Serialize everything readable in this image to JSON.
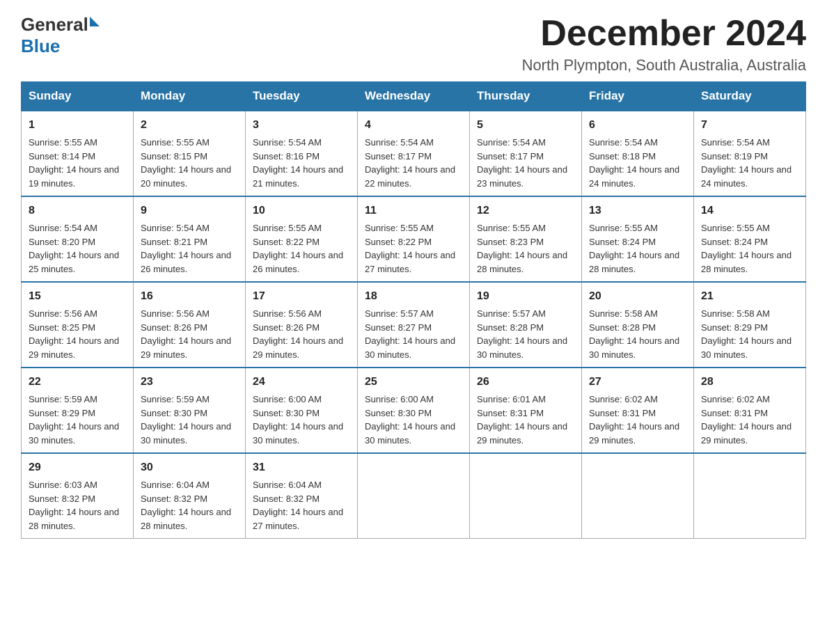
{
  "logo": {
    "general": "General",
    "blue": "Blue"
  },
  "title": "December 2024",
  "location": "North Plympton, South Australia, Australia",
  "weekdays": [
    "Sunday",
    "Monday",
    "Tuesday",
    "Wednesday",
    "Thursday",
    "Friday",
    "Saturday"
  ],
  "weeks": [
    [
      {
        "day": "1",
        "sunrise": "5:55 AM",
        "sunset": "8:14 PM",
        "daylight": "14 hours and 19 minutes."
      },
      {
        "day": "2",
        "sunrise": "5:55 AM",
        "sunset": "8:15 PM",
        "daylight": "14 hours and 20 minutes."
      },
      {
        "day": "3",
        "sunrise": "5:54 AM",
        "sunset": "8:16 PM",
        "daylight": "14 hours and 21 minutes."
      },
      {
        "day": "4",
        "sunrise": "5:54 AM",
        "sunset": "8:17 PM",
        "daylight": "14 hours and 22 minutes."
      },
      {
        "day": "5",
        "sunrise": "5:54 AM",
        "sunset": "8:17 PM",
        "daylight": "14 hours and 23 minutes."
      },
      {
        "day": "6",
        "sunrise": "5:54 AM",
        "sunset": "8:18 PM",
        "daylight": "14 hours and 24 minutes."
      },
      {
        "day": "7",
        "sunrise": "5:54 AM",
        "sunset": "8:19 PM",
        "daylight": "14 hours and 24 minutes."
      }
    ],
    [
      {
        "day": "8",
        "sunrise": "5:54 AM",
        "sunset": "8:20 PM",
        "daylight": "14 hours and 25 minutes."
      },
      {
        "day": "9",
        "sunrise": "5:54 AM",
        "sunset": "8:21 PM",
        "daylight": "14 hours and 26 minutes."
      },
      {
        "day": "10",
        "sunrise": "5:55 AM",
        "sunset": "8:22 PM",
        "daylight": "14 hours and 26 minutes."
      },
      {
        "day": "11",
        "sunrise": "5:55 AM",
        "sunset": "8:22 PM",
        "daylight": "14 hours and 27 minutes."
      },
      {
        "day": "12",
        "sunrise": "5:55 AM",
        "sunset": "8:23 PM",
        "daylight": "14 hours and 28 minutes."
      },
      {
        "day": "13",
        "sunrise": "5:55 AM",
        "sunset": "8:24 PM",
        "daylight": "14 hours and 28 minutes."
      },
      {
        "day": "14",
        "sunrise": "5:55 AM",
        "sunset": "8:24 PM",
        "daylight": "14 hours and 28 minutes."
      }
    ],
    [
      {
        "day": "15",
        "sunrise": "5:56 AM",
        "sunset": "8:25 PM",
        "daylight": "14 hours and 29 minutes."
      },
      {
        "day": "16",
        "sunrise": "5:56 AM",
        "sunset": "8:26 PM",
        "daylight": "14 hours and 29 minutes."
      },
      {
        "day": "17",
        "sunrise": "5:56 AM",
        "sunset": "8:26 PM",
        "daylight": "14 hours and 29 minutes."
      },
      {
        "day": "18",
        "sunrise": "5:57 AM",
        "sunset": "8:27 PM",
        "daylight": "14 hours and 30 minutes."
      },
      {
        "day": "19",
        "sunrise": "5:57 AM",
        "sunset": "8:28 PM",
        "daylight": "14 hours and 30 minutes."
      },
      {
        "day": "20",
        "sunrise": "5:58 AM",
        "sunset": "8:28 PM",
        "daylight": "14 hours and 30 minutes."
      },
      {
        "day": "21",
        "sunrise": "5:58 AM",
        "sunset": "8:29 PM",
        "daylight": "14 hours and 30 minutes."
      }
    ],
    [
      {
        "day": "22",
        "sunrise": "5:59 AM",
        "sunset": "8:29 PM",
        "daylight": "14 hours and 30 minutes."
      },
      {
        "day": "23",
        "sunrise": "5:59 AM",
        "sunset": "8:30 PM",
        "daylight": "14 hours and 30 minutes."
      },
      {
        "day": "24",
        "sunrise": "6:00 AM",
        "sunset": "8:30 PM",
        "daylight": "14 hours and 30 minutes."
      },
      {
        "day": "25",
        "sunrise": "6:00 AM",
        "sunset": "8:30 PM",
        "daylight": "14 hours and 30 minutes."
      },
      {
        "day": "26",
        "sunrise": "6:01 AM",
        "sunset": "8:31 PM",
        "daylight": "14 hours and 29 minutes."
      },
      {
        "day": "27",
        "sunrise": "6:02 AM",
        "sunset": "8:31 PM",
        "daylight": "14 hours and 29 minutes."
      },
      {
        "day": "28",
        "sunrise": "6:02 AM",
        "sunset": "8:31 PM",
        "daylight": "14 hours and 29 minutes."
      }
    ],
    [
      {
        "day": "29",
        "sunrise": "6:03 AM",
        "sunset": "8:32 PM",
        "daylight": "14 hours and 28 minutes."
      },
      {
        "day": "30",
        "sunrise": "6:04 AM",
        "sunset": "8:32 PM",
        "daylight": "14 hours and 28 minutes."
      },
      {
        "day": "31",
        "sunrise": "6:04 AM",
        "sunset": "8:32 PM",
        "daylight": "14 hours and 27 minutes."
      },
      null,
      null,
      null,
      null
    ]
  ],
  "labels": {
    "sunrise": "Sunrise:",
    "sunset": "Sunset:",
    "daylight": "Daylight:"
  }
}
